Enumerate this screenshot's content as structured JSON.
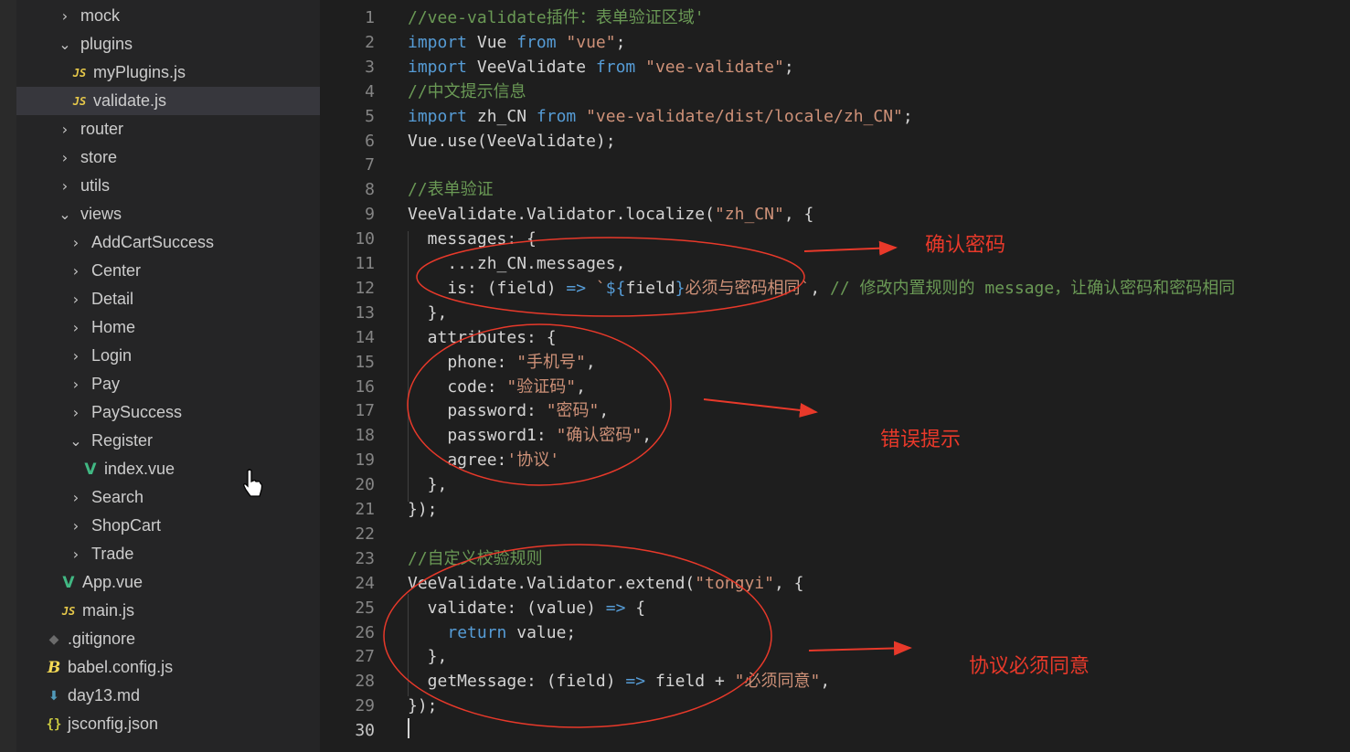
{
  "explorer": {
    "items": [
      {
        "label": "mock",
        "indent": 1,
        "kind": "folder",
        "expanded": false
      },
      {
        "label": "plugins",
        "indent": 1,
        "kind": "folder",
        "expanded": true
      },
      {
        "label": "myPlugins.js",
        "indent": 2,
        "kind": "js"
      },
      {
        "label": "validate.js",
        "indent": 2,
        "kind": "js",
        "selected": true
      },
      {
        "label": "router",
        "indent": 1,
        "kind": "folder",
        "expanded": false
      },
      {
        "label": "store",
        "indent": 1,
        "kind": "folder",
        "expanded": false
      },
      {
        "label": "utils",
        "indent": 1,
        "kind": "folder",
        "expanded": false
      },
      {
        "label": "views",
        "indent": 1,
        "kind": "folder",
        "expanded": true
      },
      {
        "label": "AddCartSuccess",
        "indent": 2,
        "kind": "folder",
        "expanded": false
      },
      {
        "label": "Center",
        "indent": 2,
        "kind": "folder",
        "expanded": false
      },
      {
        "label": "Detail",
        "indent": 2,
        "kind": "folder",
        "expanded": false
      },
      {
        "label": "Home",
        "indent": 2,
        "kind": "folder",
        "expanded": false
      },
      {
        "label": "Login",
        "indent": 2,
        "kind": "folder",
        "expanded": false
      },
      {
        "label": "Pay",
        "indent": 2,
        "kind": "folder",
        "expanded": false
      },
      {
        "label": "PaySuccess",
        "indent": 2,
        "kind": "folder",
        "expanded": false
      },
      {
        "label": "Register",
        "indent": 2,
        "kind": "folder",
        "expanded": true
      },
      {
        "label": "index.vue",
        "indent": 3,
        "kind": "vue"
      },
      {
        "label": "Search",
        "indent": 2,
        "kind": "folder",
        "expanded": false
      },
      {
        "label": "ShopCart",
        "indent": 2,
        "kind": "folder",
        "expanded": false
      },
      {
        "label": "Trade",
        "indent": 2,
        "kind": "folder",
        "expanded": false
      },
      {
        "label": "App.vue",
        "indent": 1,
        "kind": "vue"
      },
      {
        "label": "main.js",
        "indent": 1,
        "kind": "js"
      },
      {
        "label": ".gitignore",
        "indent": 0,
        "kind": "git"
      },
      {
        "label": "babel.config.js",
        "indent": 0,
        "kind": "babel"
      },
      {
        "label": "day13.md",
        "indent": 0,
        "kind": "md"
      },
      {
        "label": "jsconfig.json",
        "indent": 0,
        "kind": "json"
      }
    ]
  },
  "editor": {
    "active_line": 30,
    "lines": [
      {
        "n": 1,
        "tokens": [
          [
            "c",
            "//vee-validate插件：表单验证区域'"
          ]
        ]
      },
      {
        "n": 2,
        "tokens": [
          [
            "k",
            "import"
          ],
          [
            "t",
            " Vue "
          ],
          [
            "k",
            "from"
          ],
          [
            "t",
            " "
          ],
          [
            "s",
            "\"vue\""
          ],
          [
            "t",
            ";"
          ]
        ]
      },
      {
        "n": 3,
        "tokens": [
          [
            "k",
            "import"
          ],
          [
            "t",
            " VeeValidate "
          ],
          [
            "k",
            "from"
          ],
          [
            "t",
            " "
          ],
          [
            "s",
            "\"vee-validate\""
          ],
          [
            "t",
            ";"
          ]
        ]
      },
      {
        "n": 4,
        "tokens": [
          [
            "c",
            "//中文提示信息"
          ]
        ]
      },
      {
        "n": 5,
        "tokens": [
          [
            "k",
            "import"
          ],
          [
            "t",
            " zh_CN "
          ],
          [
            "k",
            "from"
          ],
          [
            "t",
            " "
          ],
          [
            "s",
            "\"vee-validate/dist/locale/zh_CN\""
          ],
          [
            "t",
            ";"
          ]
        ]
      },
      {
        "n": 6,
        "tokens": [
          [
            "t",
            "Vue.use(VeeValidate);"
          ]
        ]
      },
      {
        "n": 7,
        "tokens": []
      },
      {
        "n": 8,
        "tokens": [
          [
            "c",
            "//表单验证"
          ]
        ]
      },
      {
        "n": 9,
        "tokens": [
          [
            "t",
            "VeeValidate.Validator.localize("
          ],
          [
            "s",
            "\"zh_CN\""
          ],
          [
            "t",
            ", {"
          ]
        ]
      },
      {
        "n": 10,
        "tokens": [
          [
            "t",
            "  messages: {"
          ]
        ]
      },
      {
        "n": 11,
        "tokens": [
          [
            "t",
            "    ...zh_CN.messages,"
          ]
        ]
      },
      {
        "n": 12,
        "tokens": [
          [
            "t",
            "    is: (field) "
          ],
          [
            "a",
            "=>"
          ],
          [
            "t",
            " "
          ],
          [
            "s",
            "`"
          ],
          [
            "k",
            "${"
          ],
          [
            "t",
            "field"
          ],
          [
            "k",
            "}"
          ],
          [
            "s",
            "必须与密码相同`"
          ],
          [
            "t",
            ", "
          ],
          [
            "c",
            "// 修改内置规则的 message，让确认密码和密码相同"
          ]
        ]
      },
      {
        "n": 13,
        "tokens": [
          [
            "t",
            "  },"
          ]
        ]
      },
      {
        "n": 14,
        "tokens": [
          [
            "t",
            "  attributes: {"
          ]
        ]
      },
      {
        "n": 15,
        "tokens": [
          [
            "t",
            "    phone: "
          ],
          [
            "s",
            "\"手机号\""
          ],
          [
            "t",
            ","
          ]
        ]
      },
      {
        "n": 16,
        "tokens": [
          [
            "t",
            "    code: "
          ],
          [
            "s",
            "\"验证码\""
          ],
          [
            "t",
            ","
          ]
        ]
      },
      {
        "n": 17,
        "tokens": [
          [
            "t",
            "    password: "
          ],
          [
            "s",
            "\"密码\""
          ],
          [
            "t",
            ","
          ]
        ]
      },
      {
        "n": 18,
        "tokens": [
          [
            "t",
            "    password1: "
          ],
          [
            "s",
            "\"确认密码\""
          ],
          [
            "t",
            ","
          ]
        ]
      },
      {
        "n": 19,
        "tokens": [
          [
            "t",
            "    agree:"
          ],
          [
            "s",
            "'协议'"
          ]
        ]
      },
      {
        "n": 20,
        "tokens": [
          [
            "t",
            "  },"
          ]
        ]
      },
      {
        "n": 21,
        "tokens": [
          [
            "t",
            "});"
          ]
        ]
      },
      {
        "n": 22,
        "tokens": []
      },
      {
        "n": 23,
        "tokens": [
          [
            "c",
            "//自定义校验规则"
          ]
        ]
      },
      {
        "n": 24,
        "tokens": [
          [
            "t",
            "VeeValidate.Validator.extend("
          ],
          [
            "s",
            "\"tongyi\""
          ],
          [
            "t",
            ", {"
          ]
        ]
      },
      {
        "n": 25,
        "tokens": [
          [
            "t",
            "  validate: (value) "
          ],
          [
            "a",
            "=>"
          ],
          [
            "t",
            " {"
          ]
        ]
      },
      {
        "n": 26,
        "tokens": [
          [
            "t",
            "    "
          ],
          [
            "k",
            "return"
          ],
          [
            "t",
            " value;"
          ]
        ]
      },
      {
        "n": 27,
        "tokens": [
          [
            "t",
            "  },"
          ]
        ]
      },
      {
        "n": 28,
        "tokens": [
          [
            "t",
            "  getMessage: (field) "
          ],
          [
            "a",
            "=>"
          ],
          [
            "t",
            " field + "
          ],
          [
            "s",
            "\"必须同意\""
          ],
          [
            "t",
            ","
          ]
        ]
      },
      {
        "n": 29,
        "tokens": [
          [
            "t",
            "});"
          ]
        ]
      },
      {
        "n": 30,
        "tokens": []
      }
    ]
  },
  "annotations": {
    "confirm_password": "确认密码",
    "error_hint": "错误提示",
    "agree_required": "协议必须同意"
  },
  "colors": {
    "annotation_red": "#e8392a",
    "keyword": "#569cd6",
    "string": "#ce9178",
    "comment": "#6a9955"
  }
}
